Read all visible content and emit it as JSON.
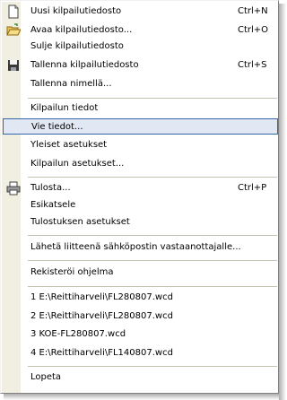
{
  "menu": {
    "items": [
      {
        "label": "Uusi kilpailutiedosto",
        "accel": "Ctrl+N",
        "icon": "new-file-icon"
      },
      {
        "label": "Avaa kilpailutiedosto...",
        "accel": "Ctrl+O",
        "icon": "open-folder-icon"
      },
      {
        "label": "Sulje kilpailutiedosto"
      },
      {
        "label": "Tallenna kilpailutiedosto",
        "accel": "Ctrl+S",
        "icon": "save-disk-icon"
      },
      {
        "label": "Tallenna nimellä..."
      },
      {
        "label": "Kilpailun tiedot"
      },
      {
        "label": "Vie tiedot...",
        "highlighted": true
      },
      {
        "label": "Yleiset asetukset"
      },
      {
        "label": "Kilpailun asetukset..."
      },
      {
        "label": "Tulosta...",
        "accel": "Ctrl+P",
        "icon": "printer-icon"
      },
      {
        "label": "Esikatsele"
      },
      {
        "label": "Tulostuksen asetukset"
      },
      {
        "label": "Lähetä liitteenä sähköpostin vastaanottajalle..."
      },
      {
        "label": "Rekisteröi ohjelma"
      },
      {
        "label": "1 E:\\Reittiharveli\\FL280807.wcd"
      },
      {
        "label": "2 E:\\Reittiharveli\\FL280807.wcd"
      },
      {
        "label": "3 KOE-FL280807.wcd"
      },
      {
        "label": "4 E:\\Reittiharveli\\FL140807.wcd"
      },
      {
        "label": "Lopeta"
      }
    ]
  },
  "colors": {
    "gutter": "#f1efe2",
    "highlight_fill": "#e1e8f3",
    "highlight_border": "#3366aa",
    "separator": "#c5c2b2"
  }
}
